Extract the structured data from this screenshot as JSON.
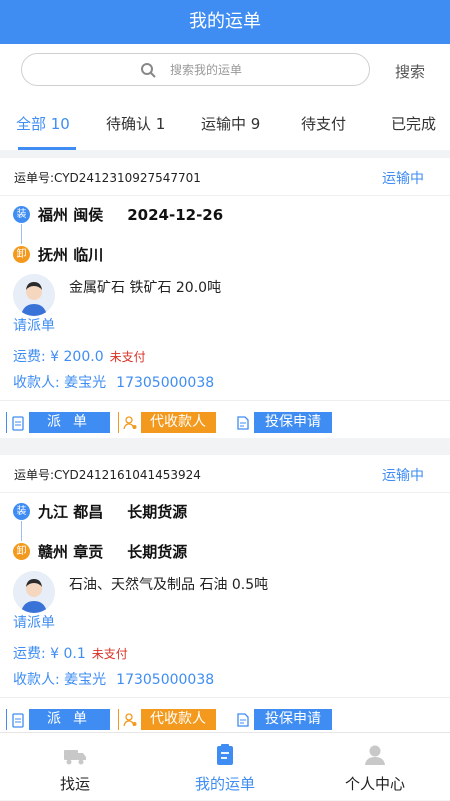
{
  "header": {
    "title": "我的运单"
  },
  "search": {
    "placeholder": "搜索我的运单",
    "button_label": "搜索"
  },
  "tabs": [
    {
      "label": "全部 10",
      "active": true
    },
    {
      "label": "待确认 1",
      "active": false
    },
    {
      "label": "运输中 9",
      "active": false
    },
    {
      "label": "待支付",
      "active": false
    },
    {
      "label": "已完成",
      "active": false
    }
  ],
  "orders": [
    {
      "order_no": "运单号:CYD2412310927547701",
      "status": "运输中",
      "load_badge": "装",
      "unload_badge": "卸",
      "origin": "福州 闽侯",
      "origin_extra": "2024-12-26",
      "destination": "抚州 临川",
      "destination_extra": "",
      "cargo": "金属矿石  铁矿石 20.0吨",
      "dispatch_hint": "请派单",
      "fee": "运费: ¥ 200.0",
      "payment_status": "未支付",
      "payee": "收款人: 姜宝光",
      "payee_phone": "17305000038",
      "actions": {
        "dispatch": "派单",
        "collect": "代收款人",
        "insure": "投保申请"
      }
    },
    {
      "order_no": "运单号:CYD2412161041453924",
      "status": "运输中",
      "load_badge": "装",
      "unload_badge": "卸",
      "origin": "九江 都昌",
      "origin_extra": "长期货源",
      "destination": "赣州 章贡",
      "destination_extra": "长期货源",
      "cargo": "石油、天然气及制品  石油 0.5吨",
      "dispatch_hint": "请派单",
      "fee": "运费: ¥ 0.1",
      "payment_status": "未支付",
      "payee": "收款人: 姜宝光",
      "payee_phone": "17305000038",
      "actions": {
        "dispatch": "派单",
        "collect": "代收款人",
        "insure": "投保申请"
      }
    }
  ],
  "bottom_nav": [
    {
      "label": "找运",
      "icon": "truck-icon",
      "active": false
    },
    {
      "label": "我的运单",
      "icon": "document-icon",
      "active": true
    },
    {
      "label": "个人中心",
      "icon": "user-icon",
      "active": false
    }
  ],
  "colors": {
    "primary": "#3f8df3",
    "warning": "#f39a1e",
    "danger": "#d93025"
  }
}
